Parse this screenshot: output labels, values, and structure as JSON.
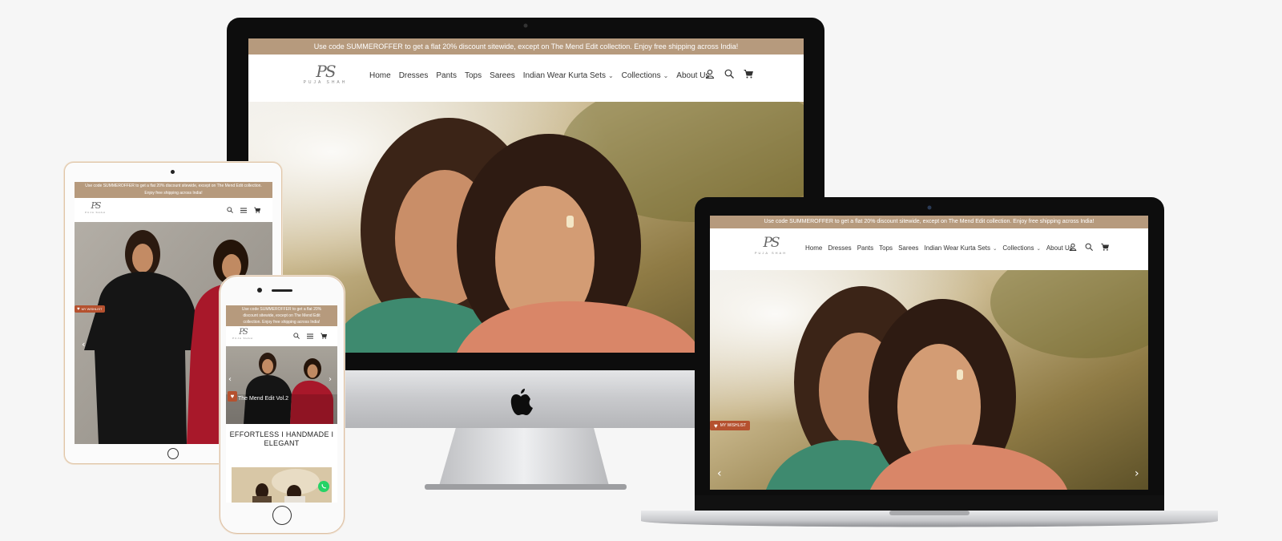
{
  "site": {
    "promo_text": "Use code SUMMEROFFER to get a flat 20% discount sitewide, except on The Mend Edit collection. Enjoy free shipping across India!",
    "promo_line1_tablet": "Use code SUMMEROFFER to get a flat 20% discount sitewide, except on The Mend Edit collection.",
    "promo_line2_tablet": "Enjoy free shipping across India!",
    "promo_line1_phone": "Use code SUMMEROFFER to get a flat 20%",
    "promo_line2_phone": "discount sitewide, except on The Mend Edit",
    "promo_line3_phone": "collection. Enjoy free shipping across India!",
    "logo_mark": "PS",
    "logo_brand": "PUJA SHAH",
    "nav": [
      "Home",
      "Dresses",
      "Pants",
      "Tops",
      "Sarees",
      "Indian Wear Kurta Sets",
      "Collections",
      "About Us"
    ],
    "nav_dropdown_indices": [
      5,
      6
    ],
    "wishlist_label": "MY WISHLIST",
    "slide_caption": "The Mend Edit Vol.2",
    "section_heading": "EFFORTLESS I HANDMADE I ELEGANT",
    "icons": [
      "user-icon",
      "search-icon",
      "cart-icon",
      "menu-icon",
      "heart-icon",
      "whatsapp-icon",
      "apple-logo-icon",
      "chevron-left-icon",
      "chevron-right-icon"
    ]
  },
  "colors": {
    "promo_bg": "#b69a7d",
    "badge_bg": "#b5512f",
    "whatsapp": "#25d366",
    "page_bg": "#f6f6f6"
  }
}
